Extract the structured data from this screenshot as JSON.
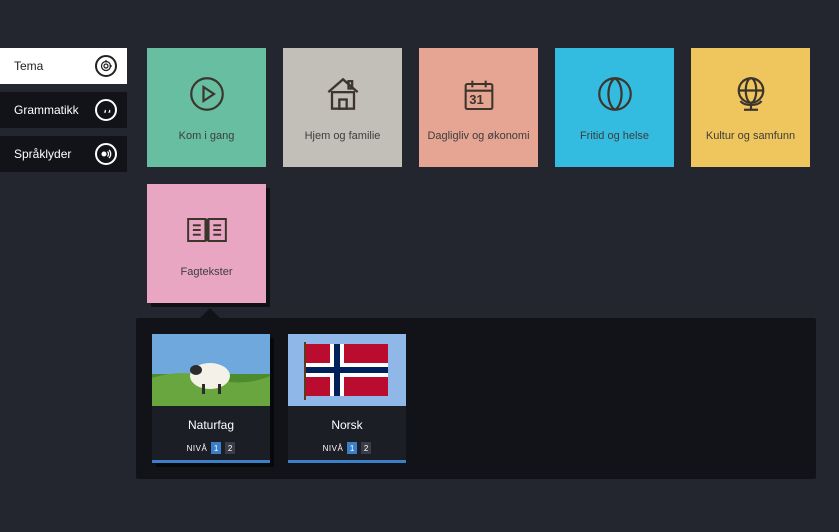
{
  "sidebar": {
    "items": [
      {
        "label": "Tema",
        "icon": "target-icon",
        "active": true
      },
      {
        "label": "Grammatikk",
        "icon": "quote-icon",
        "active": false
      },
      {
        "label": "Språklyder",
        "icon": "sound-icon",
        "active": false
      }
    ]
  },
  "tiles": [
    {
      "label": "Kom i gang",
      "icon": "play-icon",
      "color": "green"
    },
    {
      "label": "Hjem og familie",
      "icon": "house-icon",
      "color": "grey"
    },
    {
      "label": "Dagligliv og økonomi",
      "icon": "calendar-icon",
      "color": "salmon",
      "calendar_day": "31"
    },
    {
      "label": "Fritid og helse",
      "icon": "ball-icon",
      "color": "cyan"
    },
    {
      "label": "Kultur og samfunn",
      "icon": "globe-icon",
      "color": "yellow"
    },
    {
      "label": "Fagtekster",
      "icon": "book-icon",
      "color": "pink",
      "selected": true
    }
  ],
  "subitems": {
    "level_prefix": "NIVÅ",
    "cards": [
      {
        "title": "Naturfag",
        "image": "sheep",
        "levels": [
          "1",
          "2"
        ],
        "active_level": 0,
        "selected": true
      },
      {
        "title": "Norsk",
        "image": "noflag",
        "levels": [
          "1",
          "2"
        ],
        "active_level": 0,
        "selected": false
      }
    ]
  }
}
